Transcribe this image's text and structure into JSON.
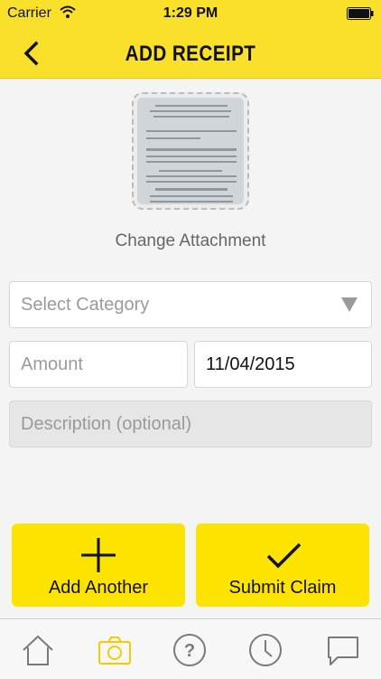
{
  "status_bar": {
    "carrier": "Carrier",
    "time": "1:29 PM"
  },
  "nav": {
    "title": "ADD RECEIPT"
  },
  "attachment": {
    "change_label": "Change Attachment"
  },
  "form": {
    "category_placeholder": "Select Category",
    "amount_placeholder": "Amount",
    "date_value": "11/04/2015",
    "description_placeholder": "Description (optional)"
  },
  "actions": {
    "add_another_label": "Add Another",
    "submit_label": "Submit Claim"
  },
  "tabs": [
    {
      "icon": "home-icon"
    },
    {
      "icon": "camera-icon",
      "active": true
    },
    {
      "icon": "help-icon"
    },
    {
      "icon": "clock-icon"
    },
    {
      "icon": "chat-icon"
    }
  ],
  "colors": {
    "accent": "#f9e02b",
    "button": "#fde400",
    "active_tab": "#f2cc00",
    "inactive_tab": "#7a7a7a"
  }
}
